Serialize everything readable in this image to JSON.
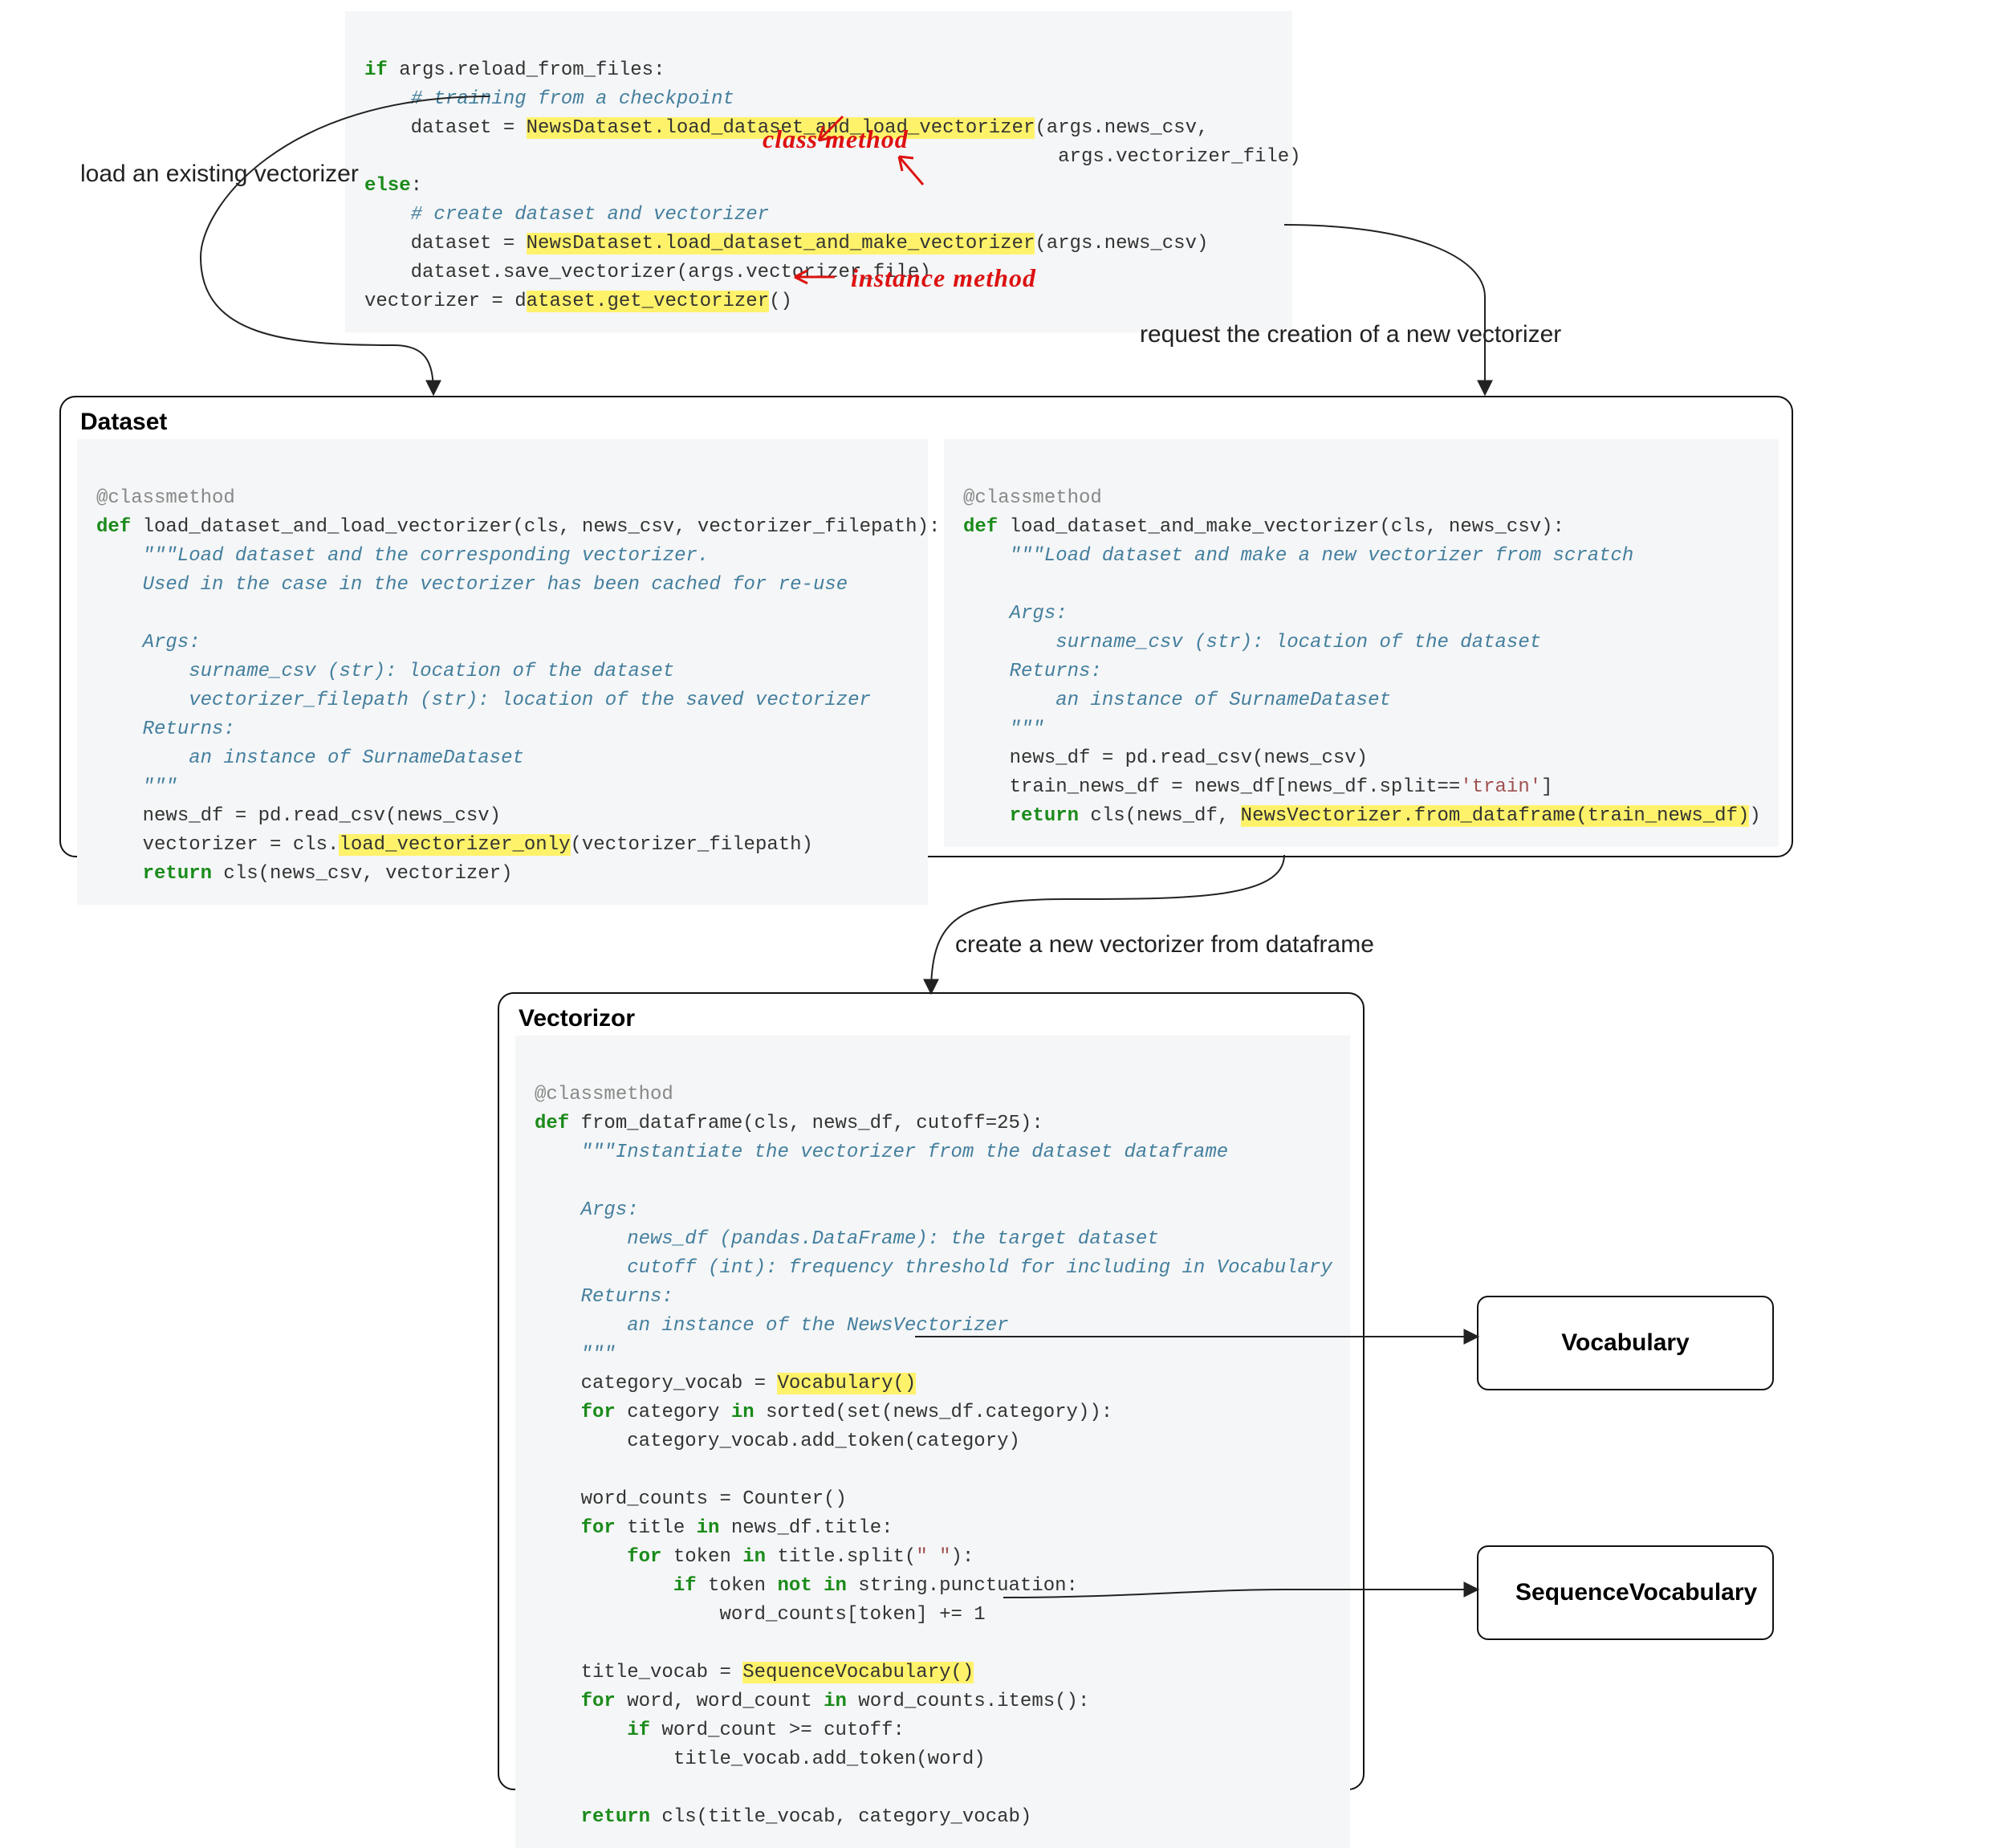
{
  "labels": {
    "load_existing": "load an existing vectorizer",
    "request_new": "request the creation of a new vectorizer",
    "create_from_df": "create a new vectorizer from dataframe"
  },
  "panels": {
    "dataset_title": "Dataset",
    "vectorizer_title": "Vectorizor"
  },
  "annotations": {
    "class_method": "class method",
    "instance_method": "instance method"
  },
  "results": {
    "vocab": "Vocabulary",
    "seqvocab": "SequenceVocabulary"
  },
  "highlights": {
    "top1": "NewsDataset.load_dataset_and_load_vectorizer",
    "top2": "NewsDataset.load_dataset_and_make_vectorizer",
    "top3": "ataset.get_vectorizer",
    "ds_left": "load_vectorizer_only",
    "ds_right": "NewsVectorizer.from_dataframe(train_news_df)",
    "vec1": "Vocabulary()",
    "vec2": "SequenceVocabulary()"
  },
  "code": {
    "top": {
      "l1_a": "if",
      "l1_b": " args.reload_from_files:",
      "l2": "    # training from a checkpoint",
      "l3_a": "    dataset = ",
      "l3_c": "(args.news_csv,",
      "l4": "                                                            args.vectorizer_file)",
      "l5_a": "else",
      "l5_b": ":",
      "l6": "    # create dataset and vectorizer",
      "l7_a": "    dataset = ",
      "l7_c": "(args.news_csv)",
      "l8": "    dataset.save_vectorizer(args.vectorizer_file)",
      "l9_a": "vectorizer = d",
      "l9_c": "()"
    },
    "dataset_left": {
      "l1": "@classmethod",
      "l2_a": "def",
      "l2_b": " load_dataset_and_load_vectorizer(cls, news_csv, vectorizer_filepath):",
      "d1": "    \"\"\"Load dataset and the corresponding vectorizer.",
      "d2": "    Used in the case in the vectorizer has been cached for re-use",
      "d3": "",
      "d4": "    Args:",
      "d5": "        surname_csv (str): location of the dataset",
      "d6": "        vectorizer_filepath (str): location of the saved vectorizer",
      "d7": "    Returns:",
      "d8": "        an instance of SurnameDataset",
      "d9": "    \"\"\"",
      "b1": "    news_df = pd.read_csv(news_csv)",
      "b2_a": "    vectorizer = cls.",
      "b2_c": "(vectorizer_filepath)",
      "b3_a": "    return",
      "b3_b": " cls(news_csv, vectorizer)"
    },
    "dataset_right": {
      "l1": "@classmethod",
      "l2_a": "def",
      "l2_b": " load_dataset_and_make_vectorizer(cls, news_csv):",
      "d1": "    \"\"\"Load dataset and make a new vectorizer from scratch",
      "d2": "",
      "d3": "    Args:",
      "d4": "        surname_csv (str): location of the dataset",
      "d5": "    Returns:",
      "d6": "        an instance of SurnameDataset",
      "d7": "    \"\"\"",
      "b1": "    news_df = pd.read_csv(news_csv)",
      "b2_a": "    train_news_df = news_df[news_df.split==",
      "b2_str": "'train'",
      "b2_c": "]",
      "b3_a": "    return",
      "b3_b": " cls(news_df, ",
      "b3_d": ")"
    },
    "vectorizer": {
      "l1": "@classmethod",
      "l2_a": "def",
      "l2_b": " from_dataframe(cls, news_df, cutoff=",
      "l2_num": "25",
      "l2_c": "):",
      "d1": "    \"\"\"Instantiate the vectorizer from the dataset dataframe",
      "d2": "",
      "d3": "    Args:",
      "d4": "        news_df (pandas.DataFrame): the target dataset",
      "d5": "        cutoff (int): frequency threshold for including in Vocabulary",
      "d6": "    Returns:",
      "d7": "        an instance of the NewsVectorizer",
      "d8": "    \"\"\"",
      "b1_a": "    category_vocab = ",
      "b2_a": "    for",
      "b2_b": " category ",
      "b2_c": "in",
      "b2_d": " sorted(set(news_df.category)):",
      "b3": "        category_vocab.add_token(category)",
      "b4": "",
      "b5": "    word_counts = Counter()",
      "b6_a": "    for",
      "b6_b": " title ",
      "b6_c": "in",
      "b6_d": " news_df.title:",
      "b7_a": "        for",
      "b7_b": " token ",
      "b7_c": "in",
      "b7_d": " title.split(",
      "b7_str": "\" \"",
      "b7_e": "):",
      "b8_a": "            if",
      "b8_b": " token ",
      "b8_c": "not in",
      "b8_d": " string.punctuation:",
      "b9_a": "                word_counts[token] += ",
      "b9_num": "1",
      "b10": "",
      "b11_a": "    title_vocab = ",
      "b12_a": "    for",
      "b12_b": " word, word_count ",
      "b12_c": "in",
      "b12_d": " word_counts.items():",
      "b13_a": "        if",
      "b13_b": " word_count >= cutoff:",
      "b14": "            title_vocab.add_token(word)",
      "b15": "",
      "b16_a": "    return",
      "b16_b": " cls(title_vocab, category_vocab)"
    }
  }
}
